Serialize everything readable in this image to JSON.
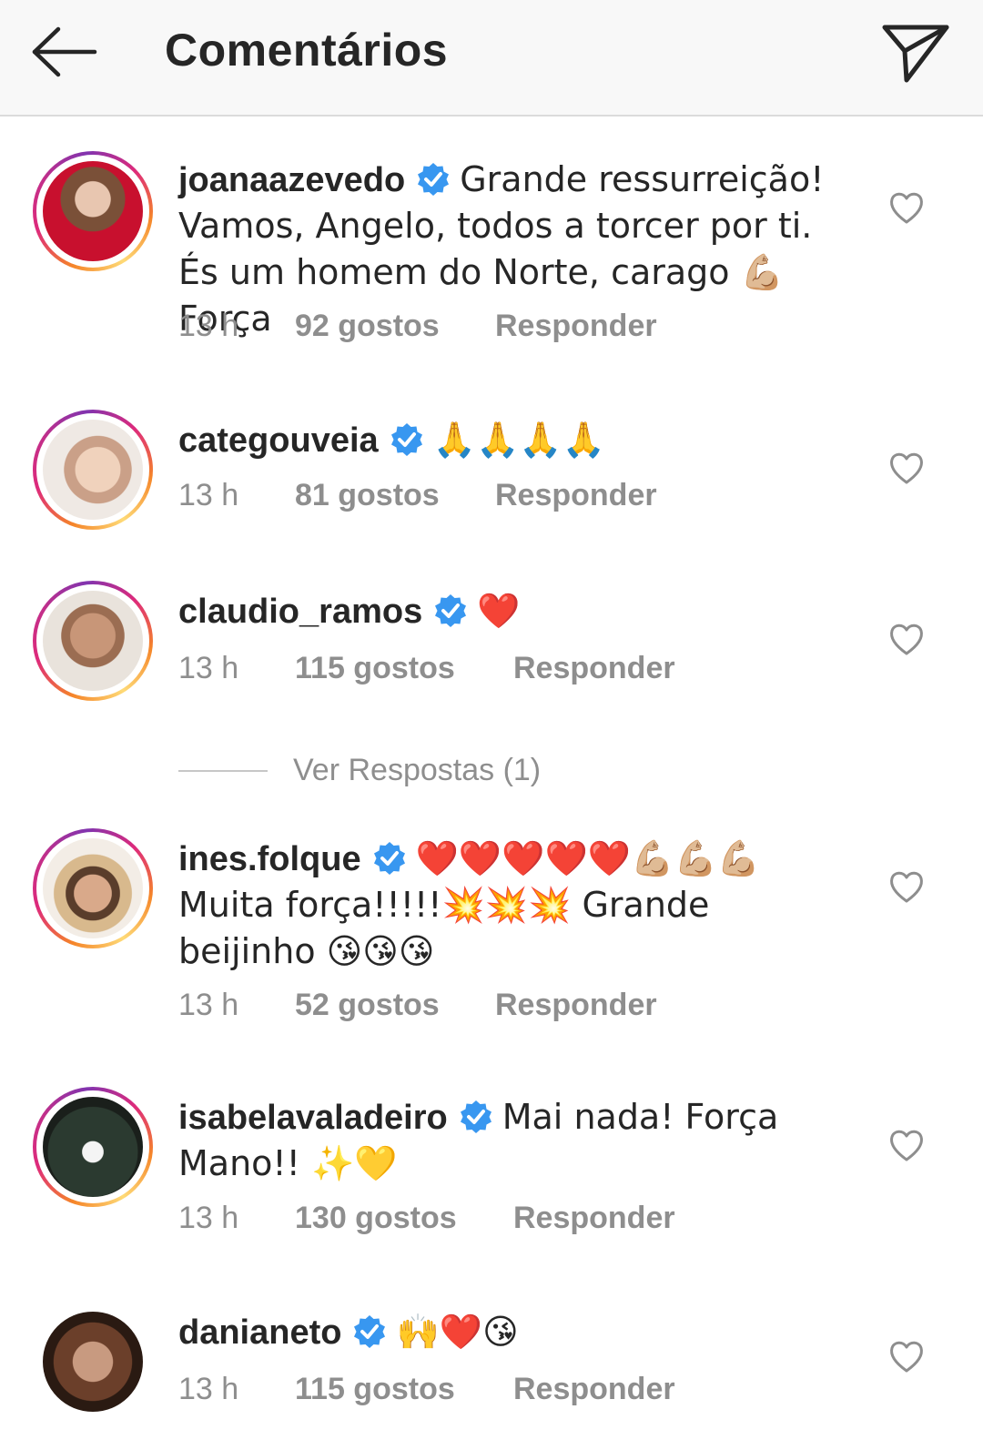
{
  "header": {
    "title": "Comentários",
    "back_icon": "arrow-left-icon",
    "send_icon": "paper-plane-icon"
  },
  "colors": {
    "verified": "#3897f0",
    "muted": "#8e8e8e",
    "text": "#262626"
  },
  "comments": [
    {
      "username": "joanaazevedo",
      "verified": true,
      "text": "Grande ressurreição! Vamos, Angelo, todos a torcer por ti. És um homem do Norte, carago 💪🏼 Força",
      "time": "13 h",
      "likes": "92 gostos",
      "reply": "Responder",
      "story_ring": true
    },
    {
      "username": "categouveia",
      "verified": true,
      "text": "🙏🙏🙏🙏",
      "time": "13 h",
      "likes": "81 gostos",
      "reply": "Responder",
      "story_ring": true
    },
    {
      "username": "claudio_ramos",
      "verified": true,
      "text": "❤️",
      "time": "13 h",
      "likes": "115 gostos",
      "reply": "Responder",
      "story_ring": true,
      "view_replies": "Ver Respostas (1)"
    },
    {
      "username": "ines.folque",
      "verified": true,
      "text": "❤️❤️❤️❤️❤️💪🏼💪🏼💪🏼 Muita força!!!!!💥💥💥 Grande beijinho 😘😘😘",
      "time": "13 h",
      "likes": "52 gostos",
      "reply": "Responder",
      "story_ring": true
    },
    {
      "username": "isabelavaladeiro",
      "verified": true,
      "text": "Mai nada! Força Mano!! ✨💛",
      "time": "13 h",
      "likes": "130 gostos",
      "reply": "Responder",
      "story_ring": true
    },
    {
      "username": "danianeto",
      "verified": true,
      "text": "🙌❤️😘",
      "time": "13 h",
      "likes": "115 gostos",
      "reply": "Responder",
      "story_ring": false
    }
  ]
}
